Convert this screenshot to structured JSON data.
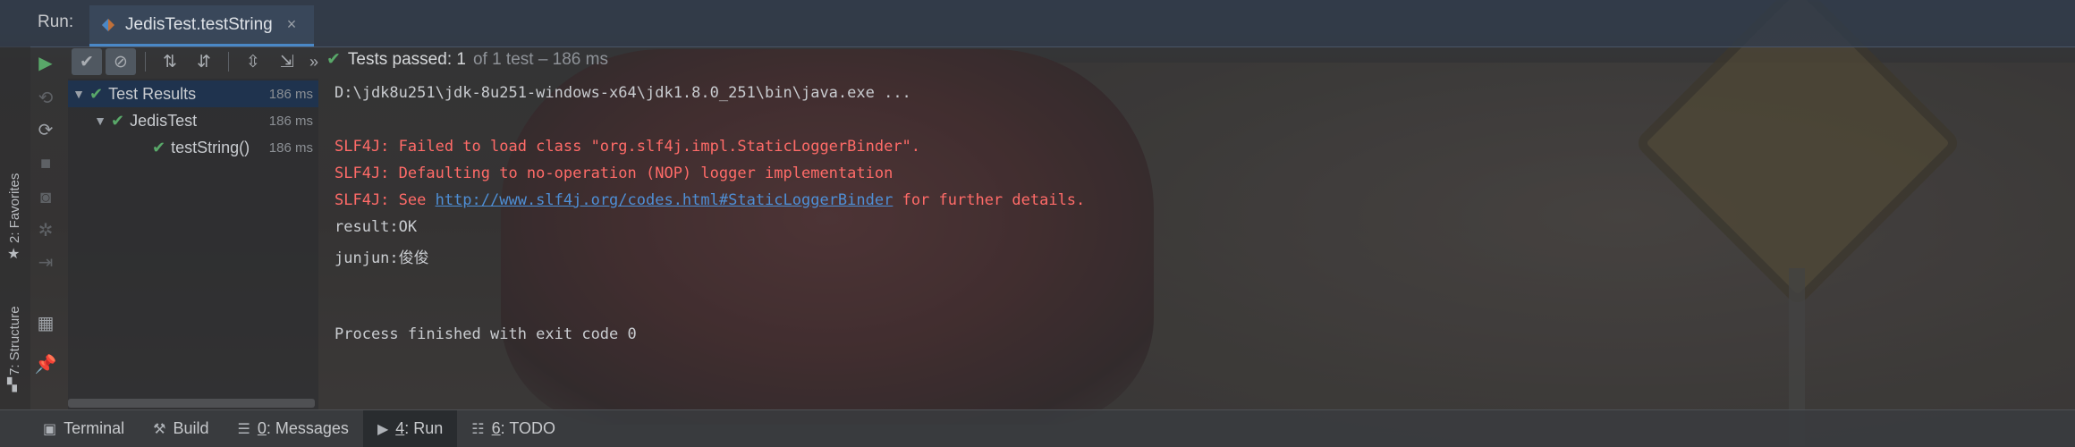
{
  "run_header": {
    "label": "Run:",
    "tab": {
      "title": "JedisTest.testString",
      "close": "×"
    }
  },
  "left_strip": {
    "favorites": "2: Favorites",
    "structure": "7: Structure"
  },
  "test_toolbar": {
    "more": "»"
  },
  "status": {
    "passed": "Tests passed: 1",
    "rest": "of 1 test – 186 ms"
  },
  "tree": [
    {
      "label": "Test Results",
      "time": "186 ms",
      "selected": true
    },
    {
      "label": "JedisTest",
      "time": "186 ms"
    },
    {
      "label": "testString()",
      "time": "186 ms"
    }
  ],
  "console": {
    "cmd": "D:\\jdk8u251\\jdk-8u251-windows-x64\\jdk1.8.0_251\\bin\\java.exe ...",
    "err1": "SLF4J: Failed to load class \"org.slf4j.impl.StaticLoggerBinder\".",
    "err2": "SLF4J: Defaulting to no-operation (NOP) logger implementation",
    "err3_pre": "SLF4J: See ",
    "err3_link": "http://www.slf4j.org/codes.html#StaticLoggerBinder",
    "err3_post": " for further details.",
    "out1": "result:OK",
    "out2": "junjun:俊俊",
    "exit": "Process finished with exit code 0"
  },
  "bottom_bar": {
    "terminal": "Terminal",
    "build": "Build",
    "messages_num": "0",
    "messages": ": Messages",
    "run_num": "4",
    "run": ": Run",
    "todo_num": "6",
    "todo": ": TODO"
  },
  "colors": {
    "error": "#ff6b68",
    "link": "#4e8fd6",
    "pass": "#59a869",
    "selection": "#1c3454"
  }
}
